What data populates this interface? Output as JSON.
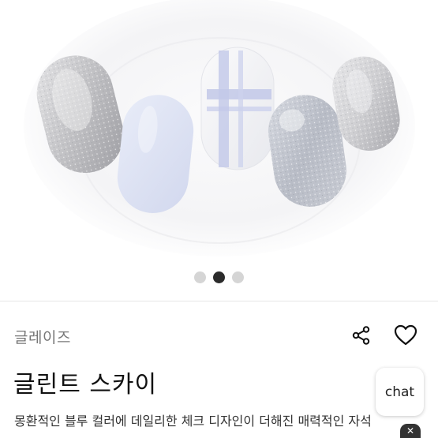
{
  "gallery": {
    "image_alt": "nail tips",
    "dots_total": 3,
    "dots_active_index": 1
  },
  "product": {
    "brand": "글레이즈",
    "title": "글린트 스카이",
    "description": "몽환적인 블루 컬러에 데일리한 체크 디자인이 더해진 매력적인 자석"
  },
  "actions": {
    "share_icon": "share-icon",
    "like_icon": "heart-icon",
    "chat_label": "chat",
    "close_icon": "close-icon"
  },
  "colors": {
    "accent_dark": "#2b2b2b",
    "nail_silver": "#c9c9cc",
    "nail_blue": "#dfe4f3",
    "check_lines": "#b8bfe3"
  }
}
